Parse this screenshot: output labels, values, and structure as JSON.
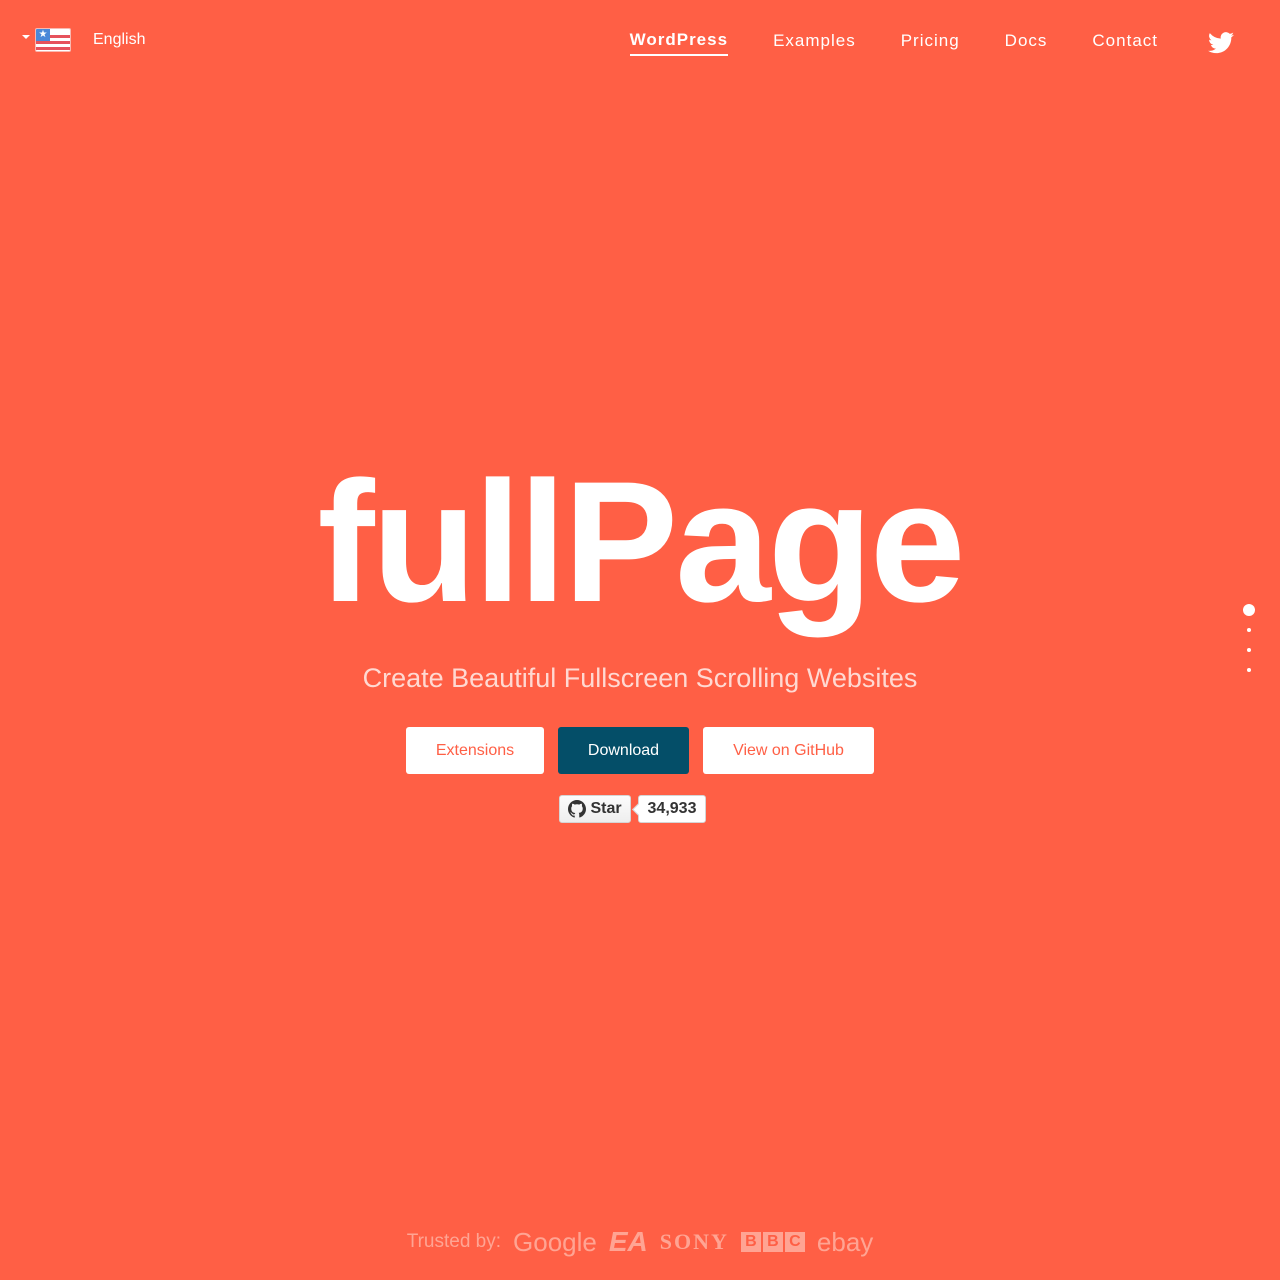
{
  "header": {
    "language": {
      "label": "English",
      "flag_icon": "us-flag-icon"
    },
    "nav": [
      {
        "label": "WordPress",
        "active": true
      },
      {
        "label": "Examples",
        "active": false
      },
      {
        "label": "Pricing",
        "active": false
      },
      {
        "label": "Docs",
        "active": false
      },
      {
        "label": "Contact",
        "active": false
      }
    ],
    "social_icon": "twitter-icon"
  },
  "hero": {
    "title": "fullPage",
    "tagline": "Create Beautiful Fullscreen Scrolling Websites",
    "buttons": {
      "extensions": "Extensions",
      "download": "Download",
      "github": "View on GitHub"
    },
    "github_star": {
      "label": "Star",
      "count": "34,933"
    }
  },
  "section_nav": {
    "count": 4,
    "active_index": 0
  },
  "trusted": {
    "label": "Trusted by:",
    "logos": [
      "Google",
      "EA",
      "SONY",
      "BBC",
      "ebay"
    ]
  },
  "colors": {
    "background": "#ff5f45",
    "download_button": "#044e68"
  }
}
